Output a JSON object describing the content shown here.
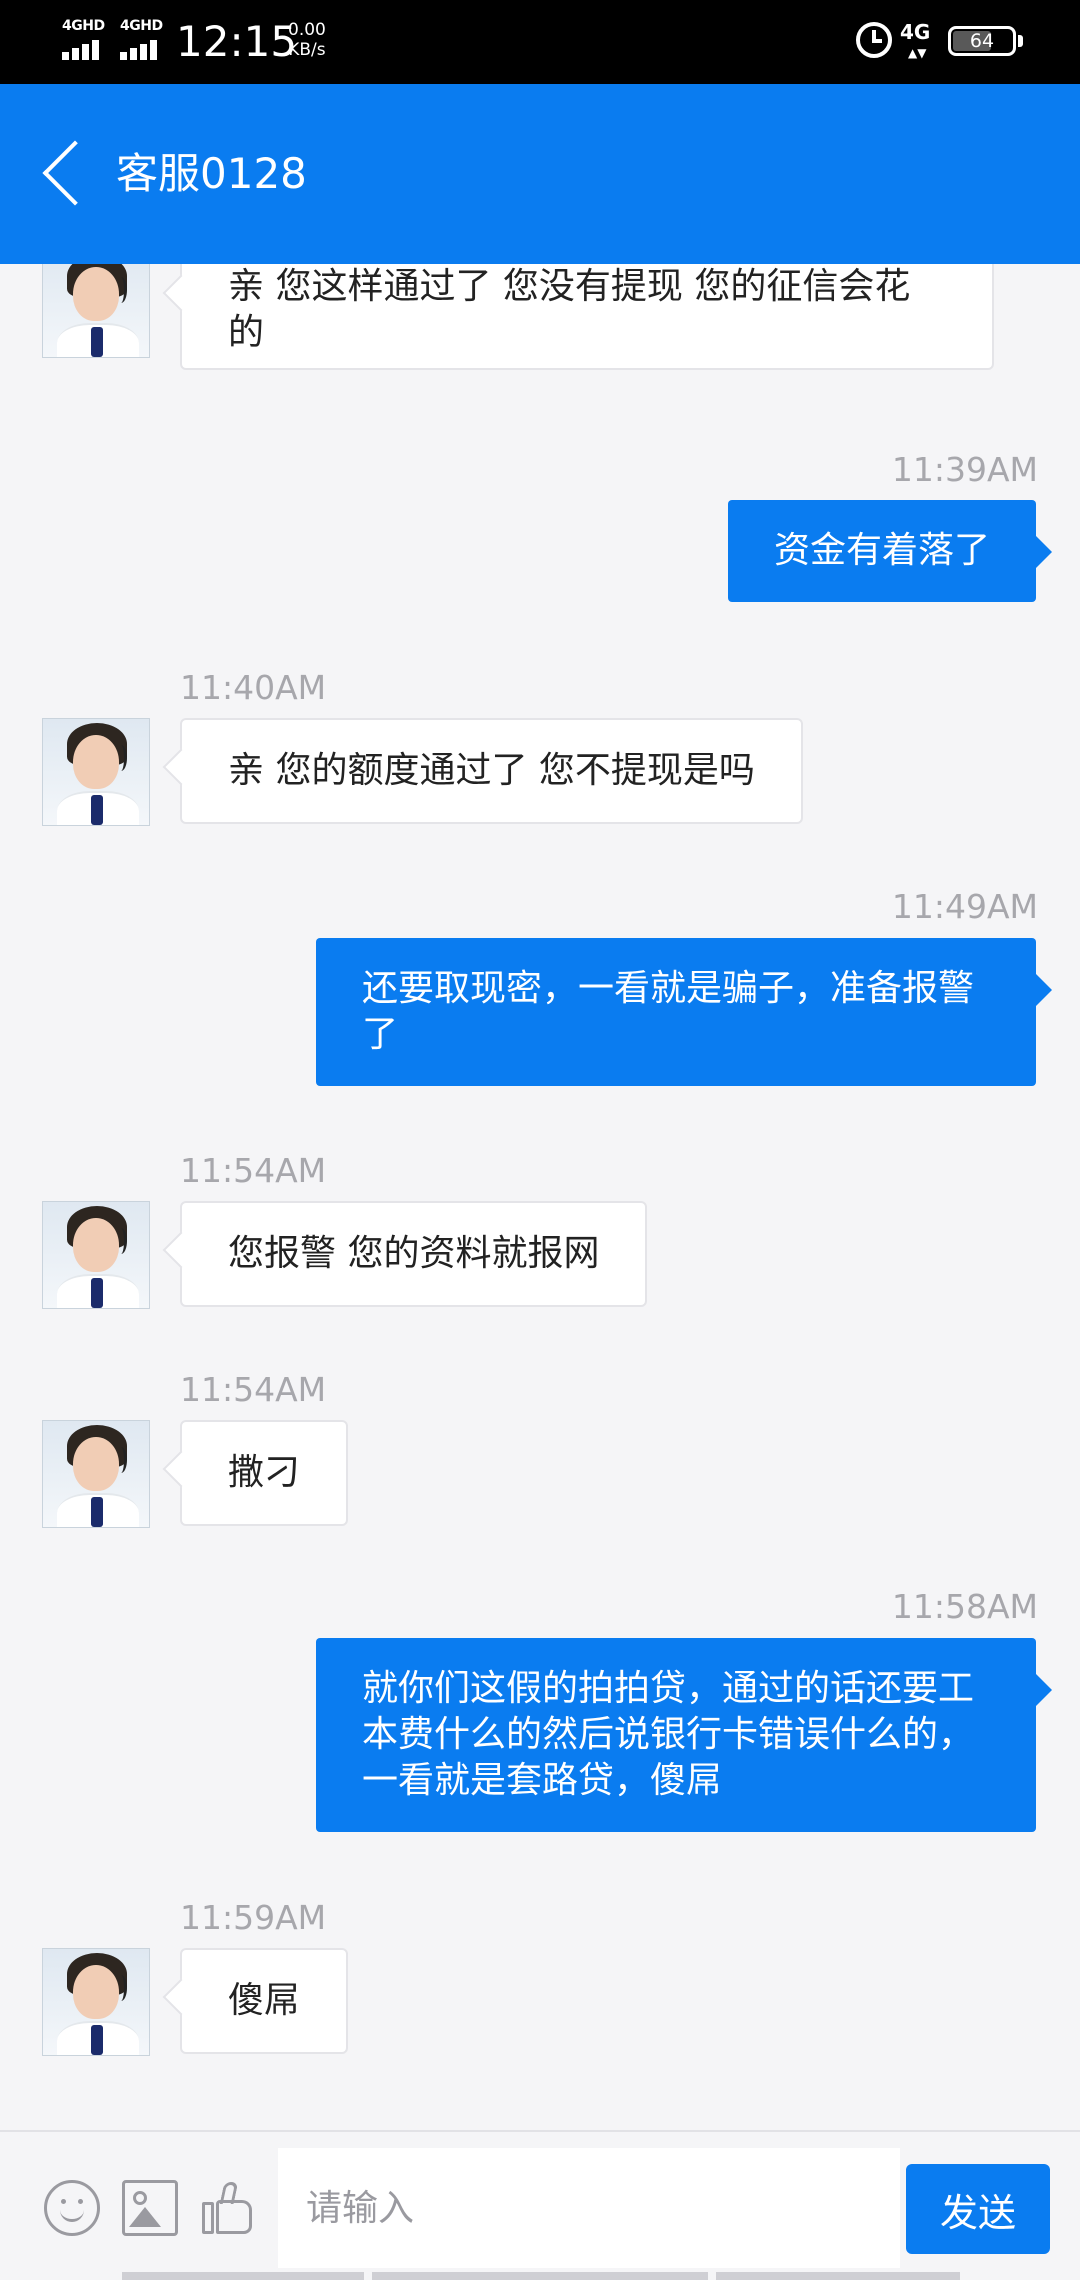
{
  "status_bar": {
    "net1": "4GHD",
    "net2": "4GHD",
    "time": "12:15",
    "speed_value": "0.00",
    "speed_unit": "KB/s",
    "network": "4G",
    "battery": "64"
  },
  "header": {
    "title": "客服0128"
  },
  "messages": [
    {
      "side": "in",
      "time": "",
      "text": "亲 您这样通过了 您没有提现 您的征信会花的"
    },
    {
      "side": "out",
      "time": "11:39AM",
      "text": "资金有着落了"
    },
    {
      "side": "in",
      "time": "11:40AM",
      "text": "亲 您的额度通过了 您不提现是吗"
    },
    {
      "side": "out",
      "time": "11:49AM",
      "text": "还要取现密，一看就是骗子，准备报警了"
    },
    {
      "side": "in",
      "time": "11:54AM",
      "text": "您报警 您的资料就报网"
    },
    {
      "side": "in",
      "time": "11:54AM",
      "text": "撒刁"
    },
    {
      "side": "out",
      "time": "11:58AM",
      "text": "就你们这假的拍拍贷，通过的话还要工本费什么的然后说银行卡错误什么的，一看就是套路贷，傻屌"
    },
    {
      "side": "in",
      "time": "11:59AM",
      "text": "傻屌"
    }
  ],
  "input": {
    "placeholder": "请输入",
    "value": "",
    "send_label": "发送"
  },
  "colors": {
    "accent": "#0a7cf0",
    "background": "#f5f5f7",
    "timestamp": "#a7a7ac"
  },
  "icons": {
    "back": "chevron-left-icon",
    "emoji": "emoji-icon",
    "image": "image-icon",
    "like": "thumbs-up-icon"
  }
}
